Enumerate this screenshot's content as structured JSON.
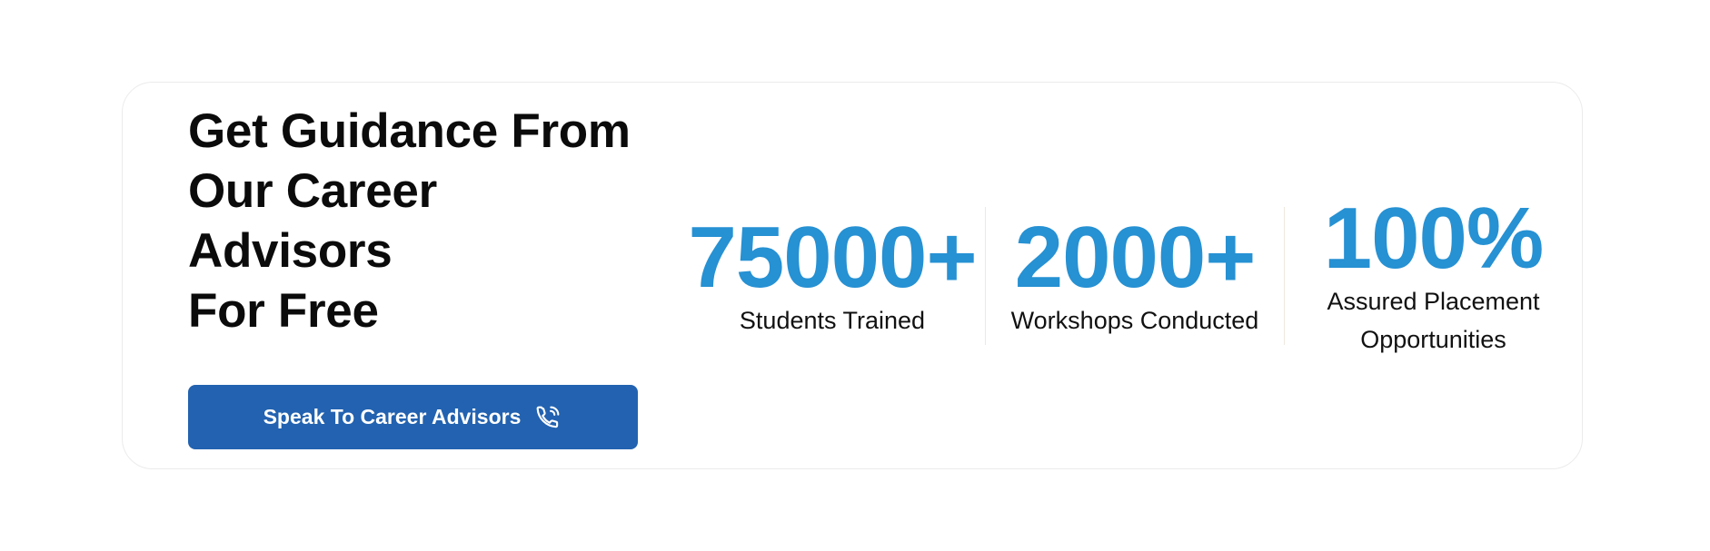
{
  "headline": {
    "lines": [
      "Get Guidance From",
      "Our Career",
      "Advisors",
      "For Free"
    ]
  },
  "cta": {
    "label": "Speak To Career Advisors",
    "icon": "phone-call-icon"
  },
  "stats": [
    {
      "value": "75000+",
      "label": "Students Trained"
    },
    {
      "value": "2000+",
      "label": "Workshops Conducted"
    },
    {
      "value": "100%",
      "label_lines": [
        "Assured Placement",
        "Opportunities"
      ]
    }
  ],
  "colors": {
    "accent": "#2691d3",
    "button": "#2262b0",
    "text": "#0b0b0b"
  }
}
